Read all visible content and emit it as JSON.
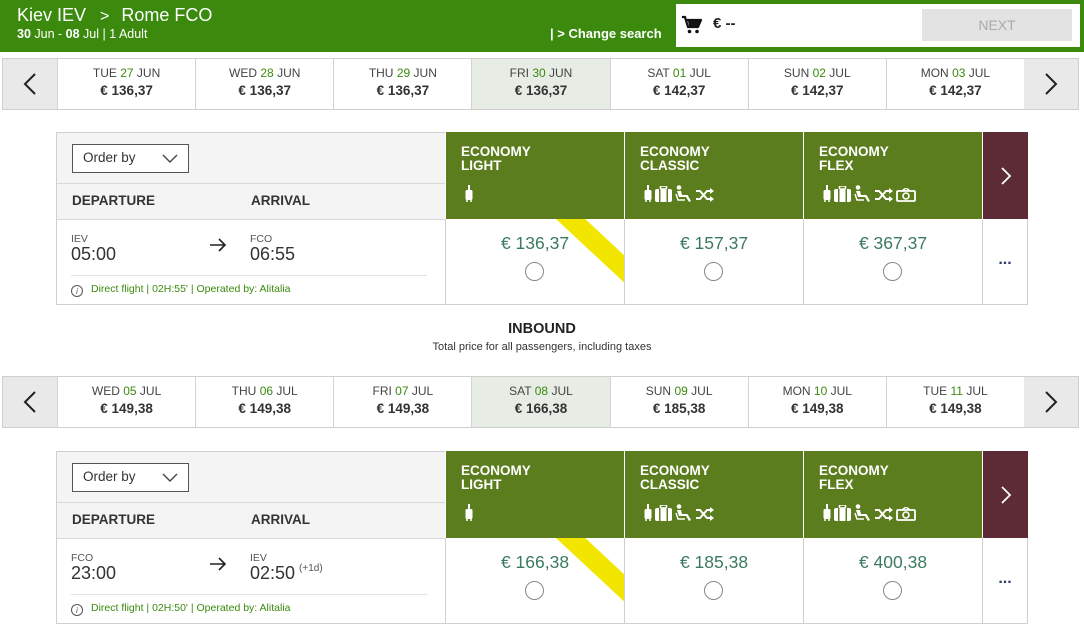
{
  "header": {
    "origin": "Kiev IEV",
    "separator": ">",
    "destination": "Rome FCO",
    "depart_day": "30",
    "depart_month": " Jun - ",
    "return_day": "08",
    "return_month": " Jul | 1 Adult",
    "change_search": "| > Change search",
    "cart_total": "€ --",
    "next_label": "NEXT"
  },
  "outbound": {
    "dates": [
      {
        "dow": "TUE",
        "day": "27",
        "mon": "JUN",
        "price": "€ 136,37",
        "selected": false
      },
      {
        "dow": "WED",
        "day": "28",
        "mon": "JUN",
        "price": "€ 136,37",
        "selected": false
      },
      {
        "dow": "THU",
        "day": "29",
        "mon": "JUN",
        "price": "€ 136,37",
        "selected": false
      },
      {
        "dow": "FRI",
        "day": "30",
        "mon": "JUN",
        "price": "€ 136,37",
        "selected": true
      },
      {
        "dow": "SAT",
        "day": "01",
        "mon": "JUL",
        "price": "€ 142,37",
        "selected": false
      },
      {
        "dow": "SUN",
        "day": "02",
        "mon": "JUL",
        "price": "€ 142,37",
        "selected": false
      },
      {
        "dow": "MON",
        "day": "03",
        "mon": "JUL",
        "price": "€ 142,37",
        "selected": false
      }
    ],
    "table": {
      "order_by": "Order by",
      "departure_label": "DEPARTURE",
      "arrival_label": "ARRIVAL",
      "dep_code": "IEV",
      "dep_time": "05:00",
      "arr_code": "FCO",
      "arr_time": "06:55",
      "plus_day": "",
      "details": "Direct flight | 02H:55' | Operated by: Alitalia",
      "fares": [
        {
          "line1": "ECONOMY",
          "line2": "LIGHT",
          "price": "€ 136,37",
          "icons": [
            "small-bag"
          ],
          "ribbon": true
        },
        {
          "line1": "ECONOMY",
          "line2": "CLASSIC",
          "price": "€ 157,37",
          "icons": [
            "small-bag",
            "checked-bag",
            "seat",
            "change"
          ],
          "ribbon": false
        },
        {
          "line1": "ECONOMY",
          "line2": "FLEX",
          "price": "€ 367,37",
          "icons": [
            "small-bag",
            "checked-bag",
            "seat",
            "change",
            "refund"
          ],
          "ribbon": false
        }
      ],
      "more": "..."
    }
  },
  "inbound_heading": {
    "title": "INBOUND",
    "subtitle": "Total price for all passengers, including taxes"
  },
  "inbound": {
    "dates": [
      {
        "dow": "WED",
        "day": "05",
        "mon": "JUL",
        "price": "€ 149,38",
        "selected": false
      },
      {
        "dow": "THU",
        "day": "06",
        "mon": "JUL",
        "price": "€ 149,38",
        "selected": false
      },
      {
        "dow": "FRI",
        "day": "07",
        "mon": "JUL",
        "price": "€ 149,38",
        "selected": false
      },
      {
        "dow": "SAT",
        "day": "08",
        "mon": "JUL",
        "price": "€ 166,38",
        "selected": true
      },
      {
        "dow": "SUN",
        "day": "09",
        "mon": "JUL",
        "price": "€ 185,38",
        "selected": false
      },
      {
        "dow": "MON",
        "day": "10",
        "mon": "JUL",
        "price": "€ 149,38",
        "selected": false
      },
      {
        "dow": "TUE",
        "day": "11",
        "mon": "JUL",
        "price": "€ 149,38",
        "selected": false
      }
    ],
    "table": {
      "order_by": "Order by",
      "departure_label": "DEPARTURE",
      "arrival_label": "ARRIVAL",
      "dep_code": "FCO",
      "dep_time": "23:00",
      "arr_code": "IEV",
      "arr_time": "02:50",
      "plus_day": "(+1d)",
      "details": "Direct flight | 02H:50' | Operated by: Alitalia",
      "fares": [
        {
          "line1": "ECONOMY",
          "line2": "LIGHT",
          "price": "€ 166,38",
          "icons": [
            "small-bag"
          ],
          "ribbon": true
        },
        {
          "line1": "ECONOMY",
          "line2": "CLASSIC",
          "price": "€ 185,38",
          "icons": [
            "small-bag",
            "checked-bag",
            "seat",
            "change"
          ],
          "ribbon": false
        },
        {
          "line1": "ECONOMY",
          "line2": "FLEX",
          "price": "€ 400,38",
          "icons": [
            "small-bag",
            "checked-bag",
            "seat",
            "change",
            "refund"
          ],
          "ribbon": false
        }
      ],
      "more": "..."
    }
  },
  "colors": {
    "header_green": "#3b8a0e",
    "fare_green": "#5c7d1d",
    "more_maroon": "#5d2b35",
    "ribbon_yellow": "#f2e600",
    "selected_date_bg": "#e7ede4"
  }
}
